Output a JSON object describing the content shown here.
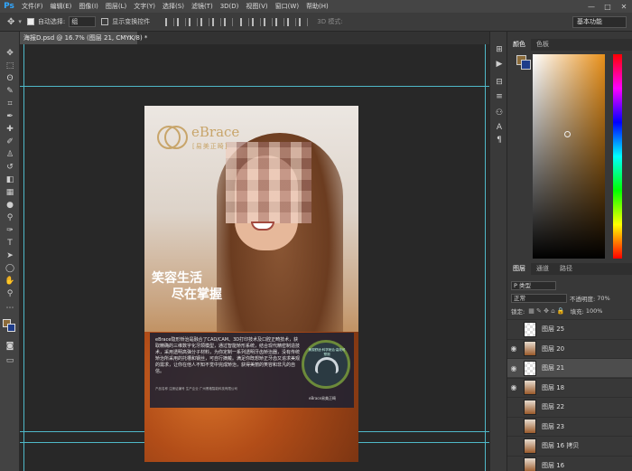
{
  "app": {
    "logo": "Ps"
  },
  "menu": [
    "文件(F)",
    "编辑(E)",
    "图像(I)",
    "图层(L)",
    "文字(Y)",
    "选择(S)",
    "滤镜(T)",
    "3D(D)",
    "视图(V)",
    "窗口(W)",
    "帮助(H)"
  ],
  "window_controls": {
    "minimize": "—",
    "maximize": "□",
    "close": "✕"
  },
  "options": {
    "auto_select_label": "自动选择:",
    "auto_select_value": "组",
    "show_transform_label": "显示变换控件",
    "mode_3d_label": "3D 模式:",
    "workspace": "基本功能"
  },
  "document": {
    "tab_title": "海报D.psd @ 16.7% (图层 21, CMYK/8) *",
    "close": "×"
  },
  "poster": {
    "brand_en": "eBrace",
    "brand_cn": "[易美正畸]",
    "slogan_line1": "笑容生活",
    "slogan_line2": "尽在掌握",
    "info": "eBrace隐形矫治是融合了CAD/CAM、3D打印技术及口腔正畸技术，获取精确的三维数字化牙颌模型，通过智能矫形系统，结合现代精密制造技术，采用透明高弹分子材料，为你定制一系列透明牙齿矫治器，没有传统矫治所采用的托槽和钢丝，可自行摘戴。满足你既想矫正牙齿又追求美观的需求，让你在他人不知不觉中完成矫治，获得美丽的笑容和非凡的自信。",
    "footer": "产品名称 注册证编号 生产企业 广州黑格智能科技有限公司",
    "badge_text": "美观舒适·科学矫治·高效可预测",
    "small_logo": "eBrace易美正畸"
  },
  "right_panel": {
    "color_tabs": [
      "颜色",
      "色板"
    ],
    "layer_tabs": [
      "图层",
      "通道",
      "路径"
    ],
    "filter_kind": "P 类型",
    "blend_mode": "正常",
    "opacity_label": "不透明度:",
    "opacity_value": "70%",
    "lock_label": "锁定:",
    "fill_label": "填充:",
    "fill_value": "100%",
    "colors": {
      "foreground": "#8b6b3a",
      "background": "#1f3d8a"
    }
  },
  "layers": [
    {
      "name": "图层 25",
      "visible": false,
      "photo": false,
      "selected": false
    },
    {
      "name": "图层 20",
      "visible": true,
      "photo": true,
      "selected": false
    },
    {
      "name": "图层 21",
      "visible": true,
      "photo": false,
      "selected": true
    },
    {
      "name": "图层 18",
      "visible": true,
      "photo": true,
      "selected": false
    },
    {
      "name": "图层 22",
      "visible": false,
      "photo": true,
      "selected": false
    },
    {
      "name": "图层 23",
      "visible": false,
      "photo": true,
      "selected": false
    },
    {
      "name": "图层 16 拷贝",
      "visible": false,
      "photo": true,
      "selected": false
    },
    {
      "name": "图层 16",
      "visible": false,
      "photo": true,
      "selected": false
    }
  ]
}
